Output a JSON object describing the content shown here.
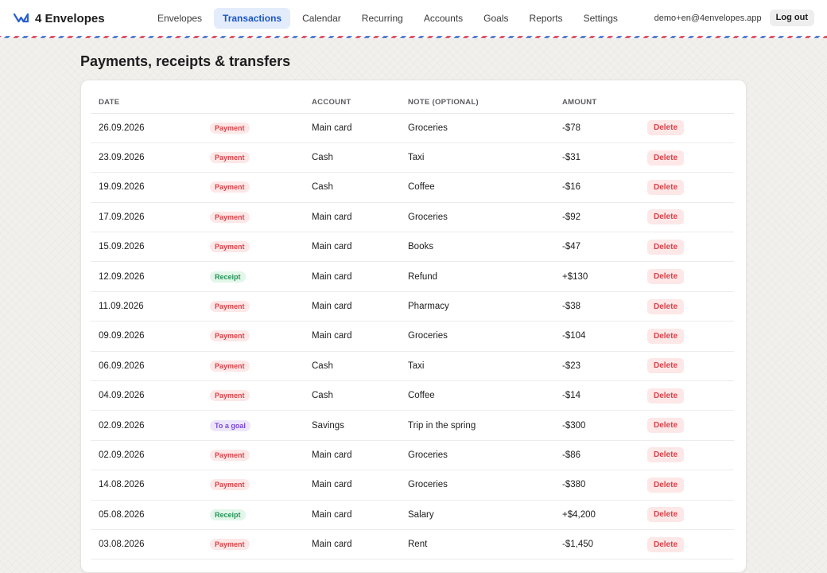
{
  "app": {
    "name": "4 Envelopes"
  },
  "nav": [
    {
      "label": "Envelopes"
    },
    {
      "label": "Transactions",
      "active": true
    },
    {
      "label": "Calendar"
    },
    {
      "label": "Recurring"
    },
    {
      "label": "Accounts"
    },
    {
      "label": "Goals"
    },
    {
      "label": "Reports"
    },
    {
      "label": "Settings"
    }
  ],
  "user": {
    "email": "demo+en@4envelopes.app",
    "logout_label": "Log out"
  },
  "page": {
    "title": "Payments, receipts & transfers"
  },
  "table": {
    "columns": [
      "DATE",
      "",
      "ACCOUNT",
      "NOTE (OPTIONAL)",
      "AMOUNT",
      ""
    ],
    "delete_label": "Delete",
    "rows": [
      {
        "date": "26.09.2026",
        "type": "Payment",
        "kind": "payment",
        "account": "Main card",
        "note": "Groceries",
        "amount": "-$78"
      },
      {
        "date": "23.09.2026",
        "type": "Payment",
        "kind": "payment",
        "account": "Cash",
        "note": "Taxi",
        "amount": "-$31"
      },
      {
        "date": "19.09.2026",
        "type": "Payment",
        "kind": "payment",
        "account": "Cash",
        "note": "Coffee",
        "amount": "-$16"
      },
      {
        "date": "17.09.2026",
        "type": "Payment",
        "kind": "payment",
        "account": "Main card",
        "note": "Groceries",
        "amount": "-$92"
      },
      {
        "date": "15.09.2026",
        "type": "Payment",
        "kind": "payment",
        "account": "Main card",
        "note": "Books",
        "amount": "-$47"
      },
      {
        "date": "12.09.2026",
        "type": "Receipt",
        "kind": "receipt",
        "account": "Main card",
        "note": "Refund",
        "amount": "+$130"
      },
      {
        "date": "11.09.2026",
        "type": "Payment",
        "kind": "payment",
        "account": "Main card",
        "note": "Pharmacy",
        "amount": "-$38"
      },
      {
        "date": "09.09.2026",
        "type": "Payment",
        "kind": "payment",
        "account": "Main card",
        "note": "Groceries",
        "amount": "-$104"
      },
      {
        "date": "06.09.2026",
        "type": "Payment",
        "kind": "payment",
        "account": "Cash",
        "note": "Taxi",
        "amount": "-$23"
      },
      {
        "date": "04.09.2026",
        "type": "Payment",
        "kind": "payment",
        "account": "Cash",
        "note": "Coffee",
        "amount": "-$14"
      },
      {
        "date": "02.09.2026",
        "type": "To a goal",
        "kind": "goal",
        "account": "Savings",
        "note": "Trip in the spring",
        "amount": "-$300"
      },
      {
        "date": "02.09.2026",
        "type": "Payment",
        "kind": "payment",
        "account": "Main card",
        "note": "Groceries",
        "amount": "-$86"
      },
      {
        "date": "14.08.2026",
        "type": "Payment",
        "kind": "payment",
        "account": "Main card",
        "note": "Groceries",
        "amount": "-$380"
      },
      {
        "date": "05.08.2026",
        "type": "Receipt",
        "kind": "receipt",
        "account": "Main card",
        "note": "Salary",
        "amount": "+$4,200"
      },
      {
        "date": "03.08.2026",
        "type": "Payment",
        "kind": "payment",
        "account": "Main card",
        "note": "Rent",
        "amount": "-$1,450"
      }
    ]
  },
  "colors": {
    "accent": "#1a56c4",
    "payment": "#d8434a",
    "receipt": "#27945a",
    "goal": "#7a48d8"
  },
  "icons": {
    "logo": "envelope-logo-icon"
  }
}
